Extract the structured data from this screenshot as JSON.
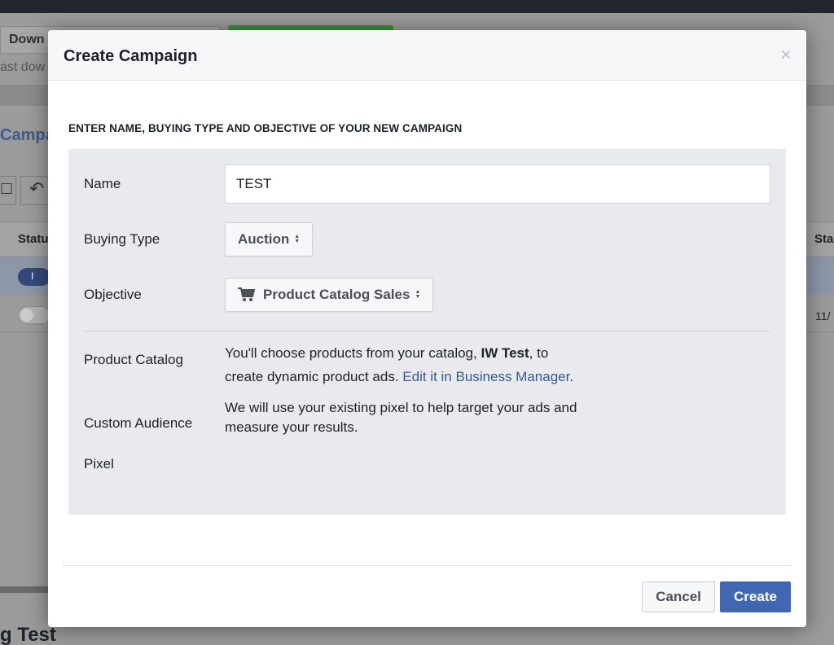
{
  "background": {
    "download_label": "Down",
    "download_subtext": "ast dow",
    "campaigns_label": "Campa",
    "status_header_left": "Statu",
    "status_header_right": "Sta",
    "toggle_on_text": "I",
    "date_fragment": "11/",
    "bottom_title": "g Test"
  },
  "modal": {
    "title": "Create Campaign",
    "close_glyph": "×",
    "section_heading": "ENTER NAME, BUYING TYPE AND OBJECTIVE OF YOUR NEW CAMPAIGN",
    "fields": {
      "name_label": "Name",
      "name_value": "TEST",
      "buying_type_label": "Buying Type",
      "buying_type_value": "Auction",
      "objective_label": "Objective",
      "objective_value": "Product Catalog Sales",
      "objective_icon": "shopping-cart-icon",
      "product_catalog_label": "Product Catalog",
      "product_catalog_text_1": "You'll choose products from your catalog, ",
      "product_catalog_name": "IW Test",
      "product_catalog_text_2": ", to",
      "product_catalog_text_3": "create dynamic product ads. ",
      "product_catalog_link": "Edit it in Business Manager",
      "product_catalog_text_4": ".",
      "custom_audience_label": "Custom Audience",
      "pixel_label": "Pixel",
      "custom_audience_text_1": "We will use your existing pixel to help target your ads and",
      "custom_audience_text_2": "measure your results."
    },
    "buttons": {
      "cancel": "Cancel",
      "create": "Create"
    }
  },
  "colors": {
    "primary_button": "#4267b2",
    "link": "#365899",
    "panel_background": "#e9eaed"
  }
}
